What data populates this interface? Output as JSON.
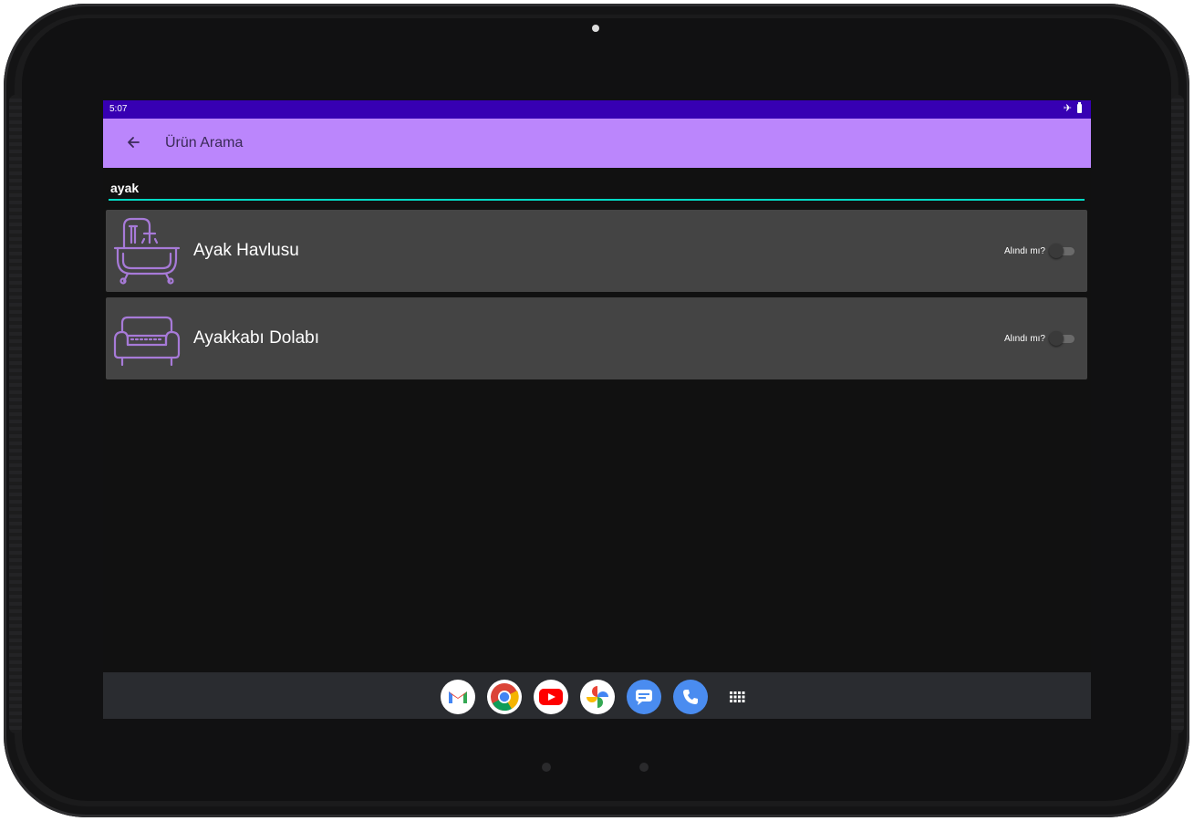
{
  "status_bar": {
    "time": "5:07"
  },
  "app_bar": {
    "title": "Ürün Arama"
  },
  "search": {
    "value": "ayak"
  },
  "products": [
    {
      "name": "Ayak Havlusu",
      "icon": "bathtub-icon",
      "switch_label": "Alındı mı?",
      "checked": false
    },
    {
      "name": "Ayakkabı Dolabı",
      "icon": "sofa-icon",
      "switch_label": "Alındı mı?",
      "checked": false
    }
  ],
  "dock": {
    "apps": [
      "gmail-icon",
      "chrome-icon",
      "youtube-icon",
      "photos-icon",
      "messages-icon",
      "phone-icon",
      "app-drawer-icon"
    ]
  },
  "colors": {
    "status_bar": "#3700b3",
    "app_bar": "#bb86fc",
    "accent": "#03dac5",
    "card": "#444444",
    "icon_stroke": "#a77ad8"
  }
}
